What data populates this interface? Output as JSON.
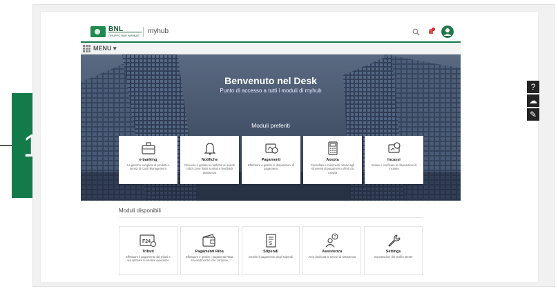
{
  "callout": {
    "number": "1"
  },
  "brand": {
    "bank": "BNL",
    "group": "GRUPPO BNP PARIBAS",
    "app": "myhub"
  },
  "menu": {
    "label": "MENU"
  },
  "hero": {
    "title": "Benvenuto nel Desk",
    "subtitle": "Punto di accesso a tutti i moduli di myhub",
    "favorites_title": "Moduli preferiti"
  },
  "favorites": [
    {
      "title": "e-banking",
      "desc": "La gamma completa di prodotti e servizi di Cash Management",
      "icon": "briefcase-icon"
    },
    {
      "title": "Notifiche",
      "desc": "Ricevere e gestire le notifiche su eventi critici come flussi scartati e feedback assistenza",
      "icon": "bell-icon"
    },
    {
      "title": "Pagamenti",
      "desc": "Effettuare e gestire le disposizioni di pagamento",
      "icon": "payment-icon"
    },
    {
      "title": "Axepta",
      "desc": "Consultare i movimenti relativi agli strumenti di pagamento offerti da Axepta",
      "icon": "calculator-icon"
    },
    {
      "title": "Incassi",
      "desc": "Inviare e verificare le disposizioni di incasso",
      "icon": "collections-icon"
    }
  ],
  "available": {
    "title": "Moduli disponibili",
    "items": [
      {
        "title": "Tributi",
        "desc": "Effettuare il pagamento dei tributi e visualizzare le relative quietanze",
        "icon": "f24-icon"
      },
      {
        "title": "Pagamenti Riba",
        "desc": "Effettuare e gestire i pagamenti RiBa sia elettroniche che cartacee",
        "icon": "wallet-icon"
      },
      {
        "title": "Stipendi",
        "desc": "Gestire il pagamento degli stipendi",
        "icon": "salary-doc-icon"
      },
      {
        "title": "Assistenza",
        "desc": "Area dedicata ai servizi di assistenza",
        "icon": "support-icon"
      },
      {
        "title": "Settings",
        "desc": "Impostazioni del profilo utente",
        "icon": "wrench-icon"
      }
    ]
  },
  "side_tools": [
    {
      "glyph": "?",
      "icon": "help-icon"
    },
    {
      "glyph": "☁",
      "icon": "cloud-upload-icon"
    },
    {
      "glyph": "✎",
      "icon": "edit-note-icon"
    }
  ],
  "colors": {
    "brand_green": "#137a4a",
    "hero_blue": "#34465f"
  }
}
